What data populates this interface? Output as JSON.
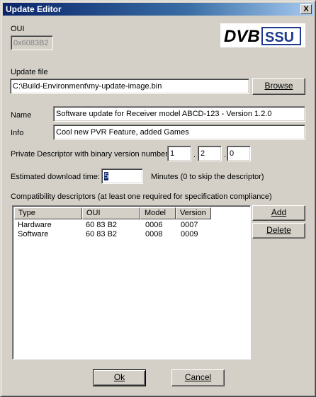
{
  "window": {
    "title": "Update Editor",
    "close_label": "X"
  },
  "oui": {
    "label": "OUI",
    "value": "0x6083B2"
  },
  "logo": {
    "text_dvb": "DVB",
    "text_ssu": "SSU",
    "color_dvb": "#000000",
    "color_ssu": "#1e3b8c"
  },
  "update_file": {
    "label": "Update file",
    "value": "C:\\Build-Environment\\my-update-image.bin",
    "browse_label": "Browse"
  },
  "name": {
    "label": "Name",
    "value": "Software update for Receiver model ABCD-123 - Version 1.2.0"
  },
  "info": {
    "label": "Info",
    "value": "Cool new PVR Feature, added Games"
  },
  "private_descriptor": {
    "label": "Private Descriptor with binary version number:",
    "v1": "1",
    "v2": "2",
    "v3": "0",
    "sep": "."
  },
  "download_time": {
    "label": "Estimated download time:",
    "value": "5",
    "hint": "Minutes (0 to skip the descriptor)"
  },
  "compat": {
    "label": "Compatibility descriptors (at least one required for specification compliance)",
    "columns": [
      "Type",
      "OUI",
      "Model",
      "Version"
    ],
    "rows": [
      [
        "Hardware",
        "60 83 B2",
        "0006",
        "0007"
      ],
      [
        "Software",
        "60 83 B2",
        "0008",
        "0009"
      ]
    ],
    "add_label": "Add",
    "delete_label": "Delete"
  },
  "footer": {
    "ok_label": "Ok",
    "cancel_label": "Cancel"
  }
}
